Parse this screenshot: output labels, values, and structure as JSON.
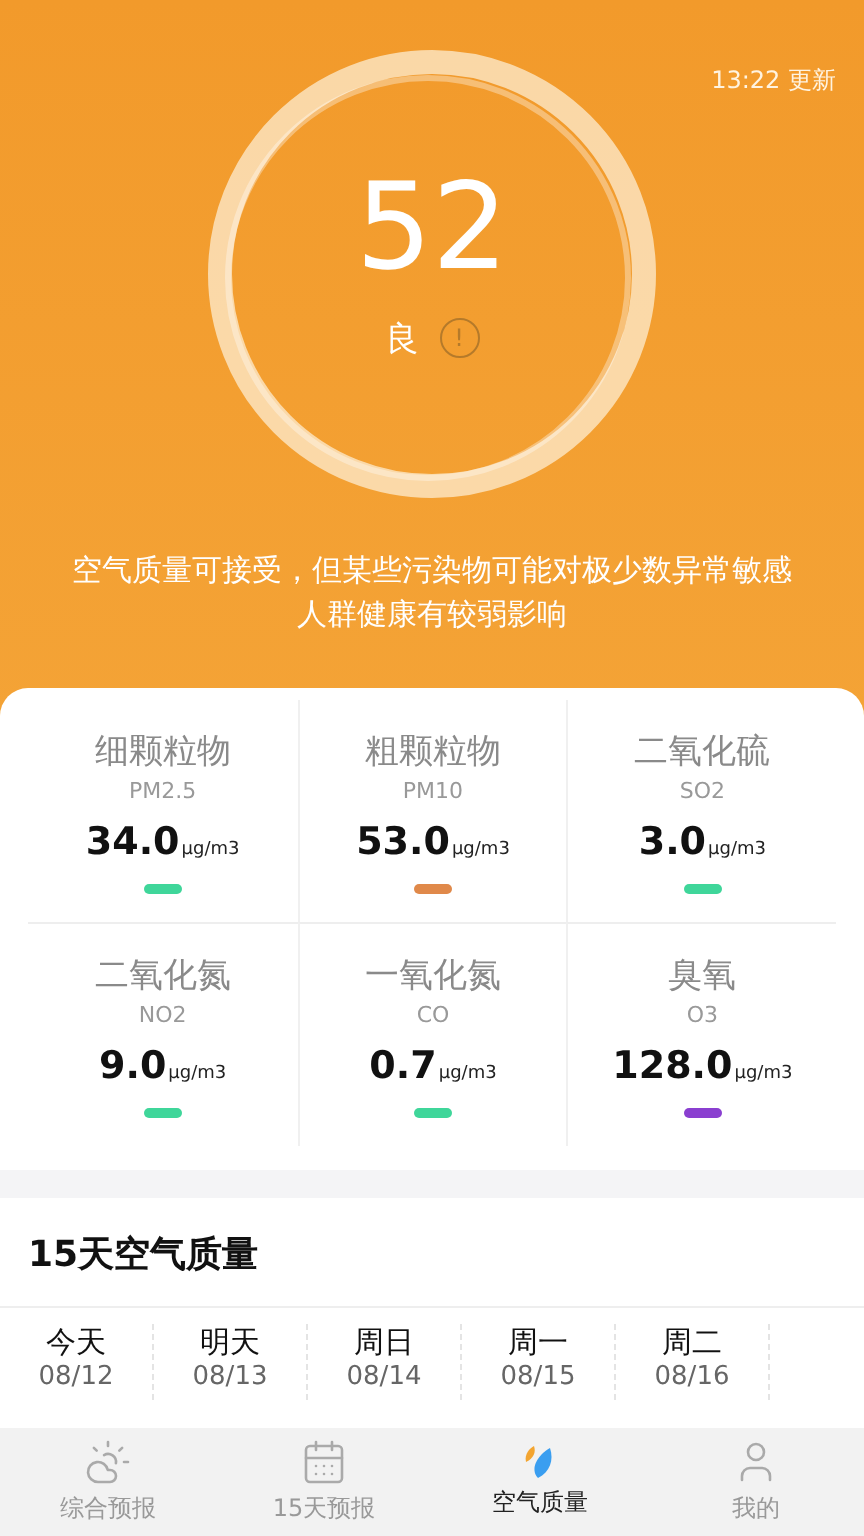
{
  "header": {
    "update_time": "13:22 更新",
    "aqi": "52",
    "level_label": "良",
    "info_icon": "!",
    "advice": "空气质量可接受，但某些污染物可能对极少数异常敏感人群健康有较弱影响"
  },
  "pollutants": [
    {
      "name": "细颗粒物",
      "code": "PM2.5",
      "value": "34.0",
      "unit": "μg/m3",
      "color": "#3fd69a"
    },
    {
      "name": "粗颗粒物",
      "code": "PM10",
      "value": "53.0",
      "unit": "μg/m3",
      "color": "#e0894a"
    },
    {
      "name": "二氧化硫",
      "code": "SO2",
      "value": "3.0",
      "unit": "μg/m3",
      "color": "#3fd69a"
    },
    {
      "name": "二氧化氮",
      "code": "NO2",
      "value": "9.0",
      "unit": "μg/m3",
      "color": "#3fd69a"
    },
    {
      "name": "一氧化氮",
      "code": "CO",
      "value": "0.7",
      "unit": "μg/m3",
      "color": "#3fd69a"
    },
    {
      "name": "臭氧",
      "code": "O3",
      "value": "128.0",
      "unit": "μg/m3",
      "color": "#8a3fd0"
    }
  ],
  "forecast": {
    "title": "15天空气质量",
    "days": [
      {
        "day": "今天",
        "date": "08/12"
      },
      {
        "day": "明天",
        "date": "08/13"
      },
      {
        "day": "周日",
        "date": "08/14"
      },
      {
        "day": "周一",
        "date": "08/15"
      },
      {
        "day": "周二",
        "date": "08/16"
      }
    ]
  },
  "tab_bar": [
    {
      "kind": "weather",
      "label": "综合预报",
      "selected": false
    },
    {
      "kind": "calendar",
      "label": "15天预报",
      "selected": false
    },
    {
      "kind": "air",
      "label": "空气质量",
      "selected": true
    },
    {
      "kind": "profile",
      "label": "我的",
      "selected": false
    }
  ]
}
